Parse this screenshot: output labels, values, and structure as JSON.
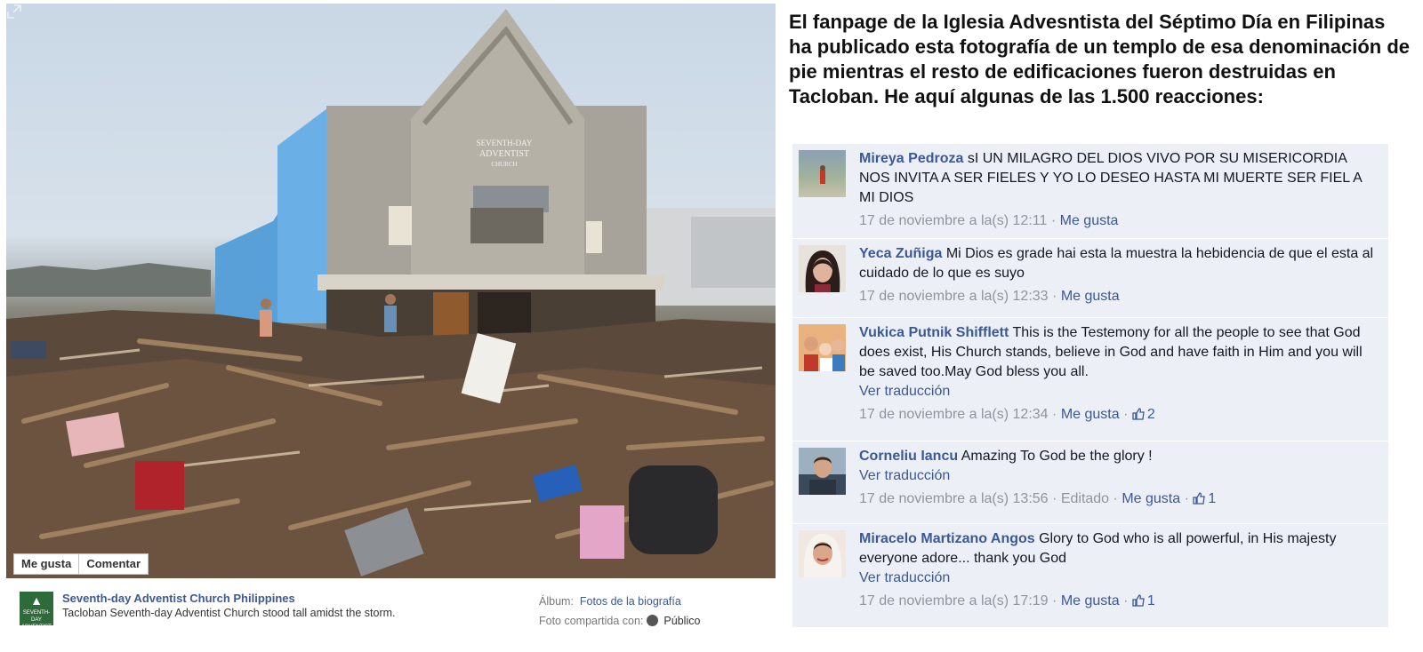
{
  "photo": {
    "church_sign_line1": "SEVENTH-DAY",
    "church_sign_line2": "ADVENTIST",
    "church_sign_line3": "CHURCH",
    "actions": [
      "Me gusta",
      "Comentar"
    ]
  },
  "caption": {
    "page_name": "Seventh-day Adventist Church Philippines",
    "description": "Tacloban Seventh-day Adventist Church stood tall amidst the storm.",
    "album_label": "Álbum:",
    "album_link": "Fotos de la biografía",
    "shared_label": "Foto compartida con:",
    "privacy": "Público",
    "logo_text": "SEVENTH-DAY ADVENTIST CHURCH"
  },
  "headline": "El fanpage de la Iglesia Advesntista del Séptimo Día en Filipinas ha publicado esta fotografía de un templo de esa denominación de pie mientras el resto de edificaciones fueron destruidas en Tacloban. He aquí algunas de las 1.500 reacciones:",
  "comments": [
    {
      "author": "Mireya Pedroza",
      "text": "sI UN MILAGRO DEL DIOS VIVO POR SU MISERICORDIA NOS INVITA A SER FIELES Y YO LO DESEO HASTA MI MUERTE SER FIEL A MI DIOS",
      "date": "17 de noviembre a la(s) 12:11",
      "sep": "·",
      "like": "Me gusta"
    },
    {
      "author": "Yeca Zuñiga",
      "text": "Mi Dios es grade hai esta la muestra la hebidencia de que el esta al cuidado de lo que es suyo",
      "date": "17 de noviembre a la(s) 12:33",
      "sep": "·",
      "like": "Me gusta"
    },
    {
      "author": "Vukica Putnik Shifflett",
      "text": "This is the Testemony for all the people to see that God does exist, His Church stands, believe in God and have faith in Him and you will be saved too.May God bless you all.",
      "translate": "Ver traducción",
      "date": "17 de noviembre a la(s) 12:34",
      "sep": "·",
      "like": "Me gusta",
      "likes": "2"
    },
    {
      "author": "Corneliu Iancu",
      "text": "Amazing To God be the glory !",
      "translate": "Ver traducción",
      "date": "17 de noviembre a la(s) 13:56",
      "edited": "Editado",
      "sep": "·",
      "like": "Me gusta",
      "likes": "1"
    },
    {
      "author": "Miracelo Martizano Angos",
      "text": "Glory to God who is all powerful, in His majesty everyone adore... thank you God",
      "translate": "Ver traducción",
      "date": "17 de noviembre a la(s) 17:19",
      "sep": "·",
      "like": "Me gusta",
      "likes": "1"
    }
  ],
  "colors": {
    "link": "#3b5998",
    "comment_bg": "#eceff5",
    "meta": "#90949c"
  }
}
